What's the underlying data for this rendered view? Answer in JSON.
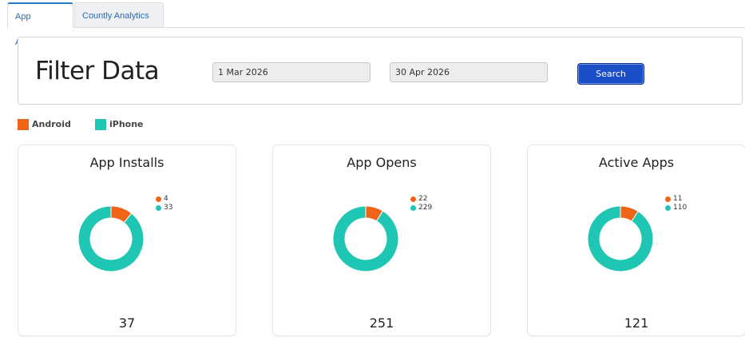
{
  "tabs": [
    {
      "label": "App Analytics",
      "active": true
    },
    {
      "label": "Countly Analytics",
      "active": false
    }
  ],
  "filter": {
    "title": "Filter Data",
    "start_date": "1 Mar 2026",
    "end_date": "30 Apr 2026",
    "search_label": "Search"
  },
  "legend": [
    {
      "label": "Android",
      "color": "#f06418"
    },
    {
      "label": "iPhone",
      "color": "#1fc6b4"
    }
  ],
  "colors": {
    "android": "#f06418",
    "iphone": "#1fc6b4",
    "accent": "#1a4fc9"
  },
  "cards": [
    {
      "title": "App Installs",
      "android": "4",
      "iphone": "33",
      "total": "37"
    },
    {
      "title": "App Opens",
      "android": "22",
      "iphone": "229",
      "total": "251"
    },
    {
      "title": "Active Apps",
      "android": "11",
      "iphone": "110",
      "total": "121"
    }
  ],
  "chart_data": [
    {
      "type": "pie",
      "title": "App Installs",
      "categories": [
        "Android",
        "iPhone"
      ],
      "values": [
        4,
        33
      ]
    },
    {
      "type": "pie",
      "title": "App Opens",
      "categories": [
        "Android",
        "iPhone"
      ],
      "values": [
        22,
        229
      ]
    },
    {
      "type": "pie",
      "title": "Active Apps",
      "categories": [
        "Android",
        "iPhone"
      ],
      "values": [
        11,
        110
      ]
    }
  ]
}
